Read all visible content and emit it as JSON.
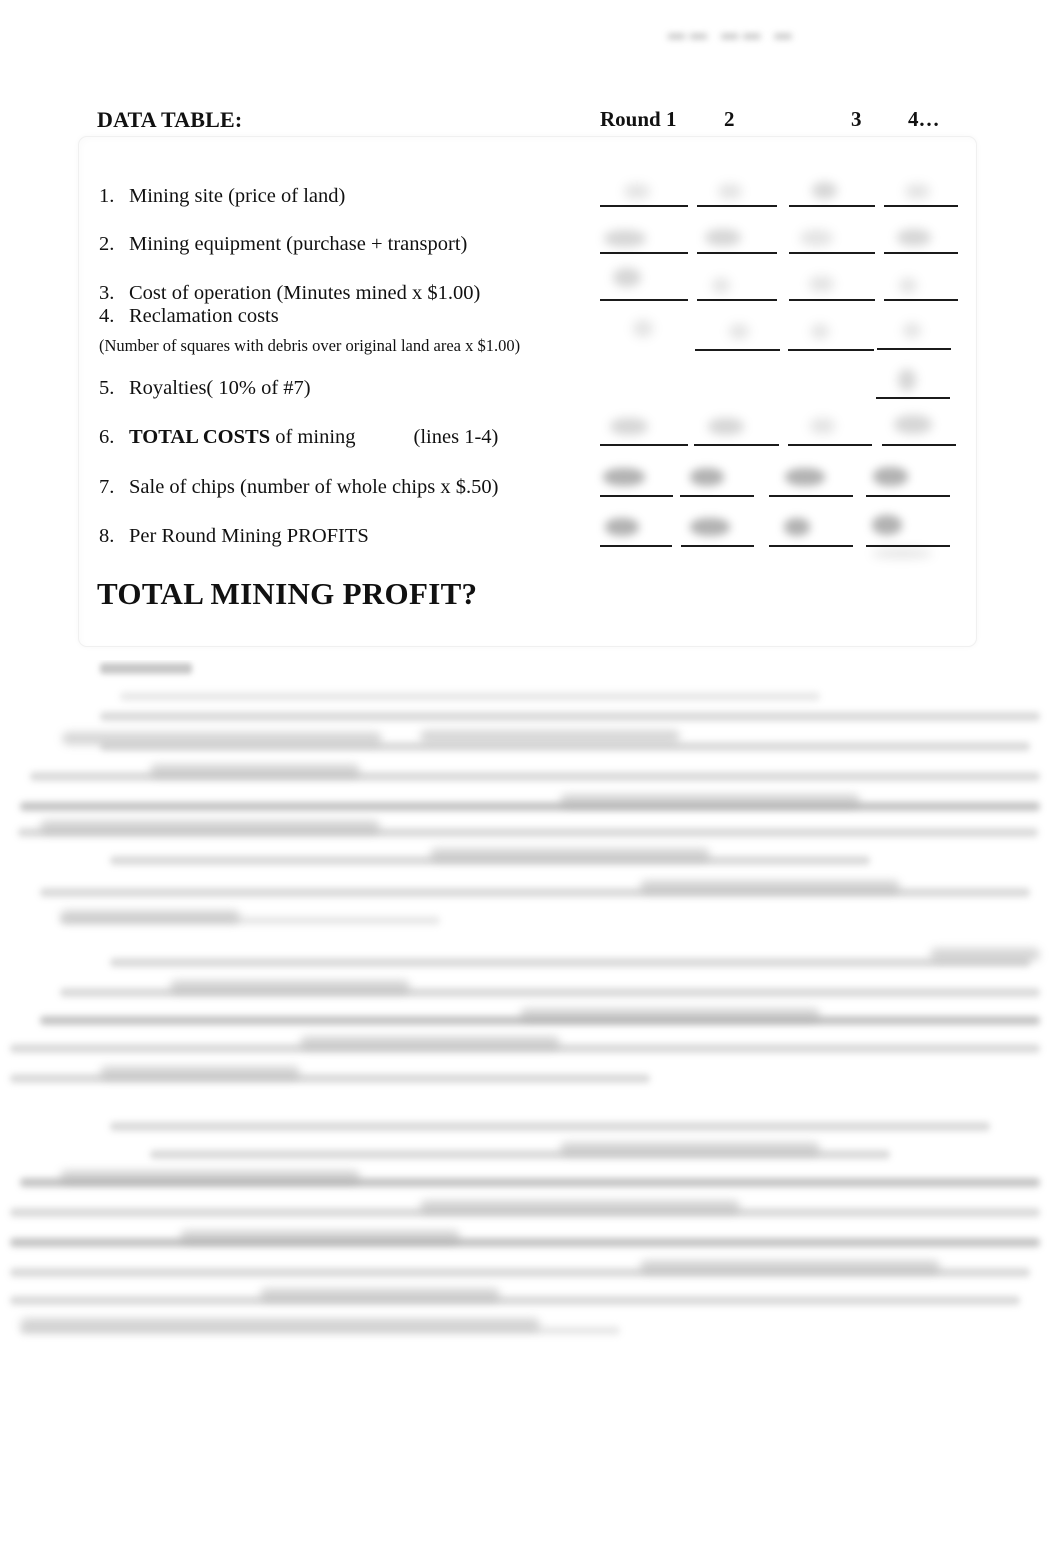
{
  "document": {
    "type": "scanned-worksheet",
    "title_label": "DATA TABLE:",
    "grand_total_heading": "TOTAL MINING PROFIT?",
    "top_margin_mark": "illegible-handwriting"
  },
  "columns": {
    "headers": [
      "Round 1",
      "2",
      "3",
      "4…"
    ]
  },
  "rows": [
    {
      "number": "1.",
      "label": "Mining site (price of land)",
      "label_plain": "Mining site (price of land)"
    },
    {
      "number": "2.",
      "label": "Mining equipment (purchase + transport)",
      "label_plain": "Mining equipment (purchase + transport)"
    },
    {
      "number": "3.",
      "label": "Cost of operation (Minutes mined x $1.00)",
      "label_plain": "Cost of operation (Minutes mined x $1.00)"
    },
    {
      "number": "4.",
      "label": "Reclamation costs",
      "label_plain": "Reclamation costs",
      "note": "(Number of squares with debris over original land area x $1.00)"
    },
    {
      "number": "5.",
      "label": "Royalties( 10% of #7)",
      "label_plain": "Royalties( 10% of #7)"
    },
    {
      "number": "6.",
      "label_bold": "TOTAL COSTS",
      "label_rest": " of mining",
      "label_trailing": "(lines 1-4)",
      "label_plain": "TOTAL COSTS of mining   (lines 1-4)"
    },
    {
      "number": "7.",
      "label": "Sale of chips (number of whole chips x $.50)",
      "label_plain": "Sale of chips (number of whole chips x $.50)"
    },
    {
      "number": "8.",
      "label": "Per Round Mining PROFITS",
      "label_plain": "Per Round Mining PROFITS"
    }
  ],
  "entries": {
    "description": "Handwritten values in the answer blanks are blurred and illegible in the scan",
    "legible": false,
    "value": ""
  },
  "discussion": {
    "heading": "",
    "legible": false,
    "note": "Lower half of page is blurred printed questions with illegible handwritten answers"
  },
  "colors": {
    "page_background": "#ffffff",
    "text": "#111111",
    "rule_line": "#1b1b1b",
    "box_border": "#f0f0f0",
    "smudge": "#8e8e8e"
  }
}
